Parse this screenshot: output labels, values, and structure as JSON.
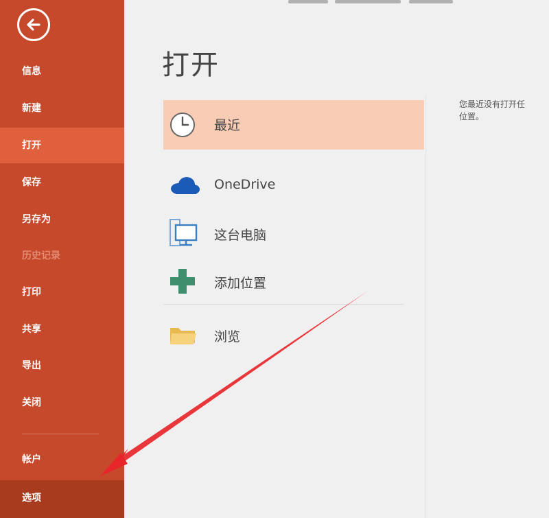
{
  "sidebar": {
    "back": {
      "icon": "back-arrow-icon"
    },
    "items": [
      {
        "label": "信息",
        "state": "normal"
      },
      {
        "label": "新建",
        "state": "normal"
      },
      {
        "label": "打开",
        "state": "active"
      },
      {
        "label": "保存",
        "state": "normal"
      },
      {
        "label": "另存为",
        "state": "normal"
      },
      {
        "label": "历史记录",
        "state": "disabled"
      },
      {
        "label": "打印",
        "state": "normal"
      },
      {
        "label": "共享",
        "state": "normal"
      },
      {
        "label": "导出",
        "state": "normal"
      },
      {
        "label": "关闭",
        "state": "normal"
      }
    ],
    "account": {
      "label": "帐户"
    },
    "options": {
      "label": "选项"
    }
  },
  "main": {
    "title": "打开",
    "locations": [
      {
        "label": "最近",
        "icon": "clock-icon",
        "selected": true
      },
      {
        "label": "OneDrive",
        "icon": "onedrive-cloud-icon",
        "selected": false
      },
      {
        "label": "这台电脑",
        "icon": "computer-icon",
        "selected": false
      },
      {
        "label": "添加位置",
        "icon": "plus-icon",
        "selected": false
      },
      {
        "label": "浏览",
        "icon": "folder-icon",
        "selected": false
      }
    ],
    "right_message": {
      "line1": "您最近没有打开任",
      "line2": "位置。"
    }
  },
  "colors": {
    "sidebar_bg": "#c5492a",
    "sidebar_active": "#e0603e",
    "sidebar_options": "#a83a1e",
    "selected_location": "#f9ccb5",
    "annotation_arrow": "#e8262a"
  }
}
